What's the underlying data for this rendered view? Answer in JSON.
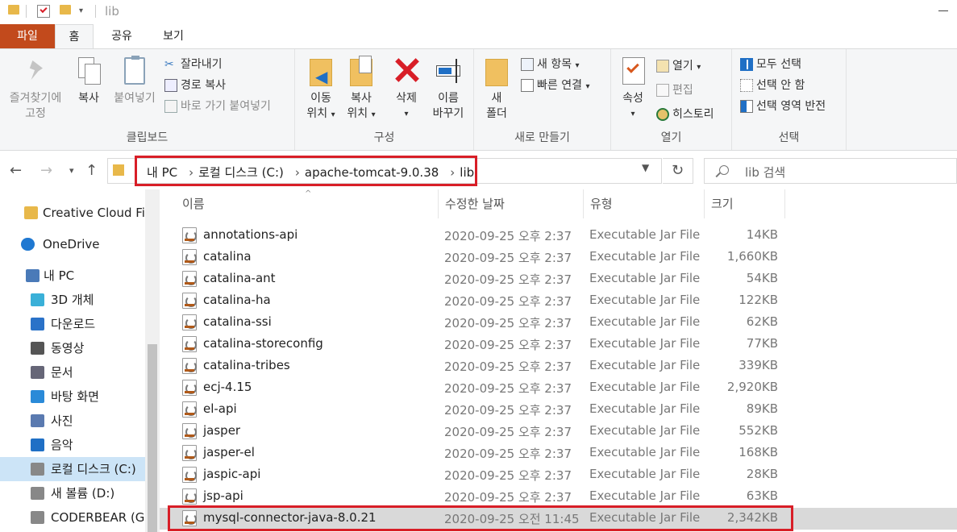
{
  "window": {
    "title": "lib"
  },
  "tabs": {
    "file": "파일",
    "home": "홈",
    "share": "공유",
    "view": "보기"
  },
  "ribbon": {
    "clipboard": {
      "label": "클립보드",
      "pin": "즐겨찾기에\n고정",
      "pin_line1": "즐겨찾기에",
      "pin_line2": "고정",
      "copy": "복사",
      "paste": "붙여넣기",
      "cut": "잘라내기",
      "copy_path": "경로 복사",
      "paste_shortcut": "바로 가기 붙여넣기"
    },
    "organize": {
      "label": "구성",
      "move_l1": "이동",
      "move_l2": "위치",
      "copy_l1": "복사",
      "copy_l2": "위치",
      "delete": "삭제",
      "rename_l1": "이름",
      "rename_l2": "바꾸기"
    },
    "new": {
      "label": "새로 만들기",
      "folder_l1": "새",
      "folder_l2": "폴더",
      "new_item": "새 항목",
      "easy_access": "빠른 연결"
    },
    "open": {
      "label": "열기",
      "properties": "속성",
      "open": "열기",
      "edit": "편집",
      "history": "히스토리"
    },
    "select": {
      "label": "선택",
      "select_all": "모두 선택",
      "select_none": "선택 안 함",
      "invert": "선택 영역 반전"
    }
  },
  "address": {
    "crumbs": [
      "내 PC",
      "로컬 디스크 (C:)",
      "apache-tomcat-9.0.38",
      "lib"
    ],
    "search_placeholder": "lib 검색"
  },
  "nav": [
    {
      "label": "Creative Cloud Files",
      "icon": "creative-cloud-icon"
    },
    {
      "label": "OneDrive",
      "icon": "onedrive-icon"
    },
    {
      "label": "내 PC",
      "icon": "pc-icon"
    },
    {
      "label": "3D 개체",
      "icon": "3d-objects-icon"
    },
    {
      "label": "다운로드",
      "icon": "download-icon"
    },
    {
      "label": "동영상",
      "icon": "video-icon"
    },
    {
      "label": "문서",
      "icon": "document-icon"
    },
    {
      "label": "바탕 화면",
      "icon": "desktop-icon"
    },
    {
      "label": "사진",
      "icon": "pictures-icon"
    },
    {
      "label": "음악",
      "icon": "music-icon"
    },
    {
      "label": "로컬 디스크 (C:)",
      "icon": "drive-icon"
    },
    {
      "label": "새 볼륨 (D:)",
      "icon": "drive-icon"
    },
    {
      "label": "CODERBEAR (G:)",
      "icon": "drive-icon"
    }
  ],
  "columns": {
    "name": "이름",
    "date": "수정한 날짜",
    "type": "유형",
    "size": "크기"
  },
  "files": [
    {
      "name": "annotations-api",
      "date": "2020-09-25 오후 2:37",
      "type": "Executable Jar File",
      "size": "14KB"
    },
    {
      "name": "catalina",
      "date": "2020-09-25 오후 2:37",
      "type": "Executable Jar File",
      "size": "1,660KB"
    },
    {
      "name": "catalina-ant",
      "date": "2020-09-25 오후 2:37",
      "type": "Executable Jar File",
      "size": "54KB"
    },
    {
      "name": "catalina-ha",
      "date": "2020-09-25 오후 2:37",
      "type": "Executable Jar File",
      "size": "122KB"
    },
    {
      "name": "catalina-ssi",
      "date": "2020-09-25 오후 2:37",
      "type": "Executable Jar File",
      "size": "62KB"
    },
    {
      "name": "catalina-storeconfig",
      "date": "2020-09-25 오후 2:37",
      "type": "Executable Jar File",
      "size": "77KB"
    },
    {
      "name": "catalina-tribes",
      "date": "2020-09-25 오후 2:37",
      "type": "Executable Jar File",
      "size": "339KB"
    },
    {
      "name": "ecj-4.15",
      "date": "2020-09-25 오후 2:37",
      "type": "Executable Jar File",
      "size": "2,920KB"
    },
    {
      "name": "el-api",
      "date": "2020-09-25 오후 2:37",
      "type": "Executable Jar File",
      "size": "89KB"
    },
    {
      "name": "jasper",
      "date": "2020-09-25 오후 2:37",
      "type": "Executable Jar File",
      "size": "552KB"
    },
    {
      "name": "jasper-el",
      "date": "2020-09-25 오후 2:37",
      "type": "Executable Jar File",
      "size": "168KB"
    },
    {
      "name": "jaspic-api",
      "date": "2020-09-25 오후 2:37",
      "type": "Executable Jar File",
      "size": "28KB"
    },
    {
      "name": "jsp-api",
      "date": "2020-09-25 오후 2:37",
      "type": "Executable Jar File",
      "size": "63KB"
    },
    {
      "name": "mysql-connector-java-8.0.21",
      "date": "2020-09-25 오전 11:45",
      "type": "Executable Jar File",
      "size": "2,342KB"
    }
  ],
  "colors": {
    "file_tab": "#c24a1c",
    "highlight": "#d81e27",
    "selection": "#d9d9d9",
    "nav_selection": "#cce4f7"
  }
}
